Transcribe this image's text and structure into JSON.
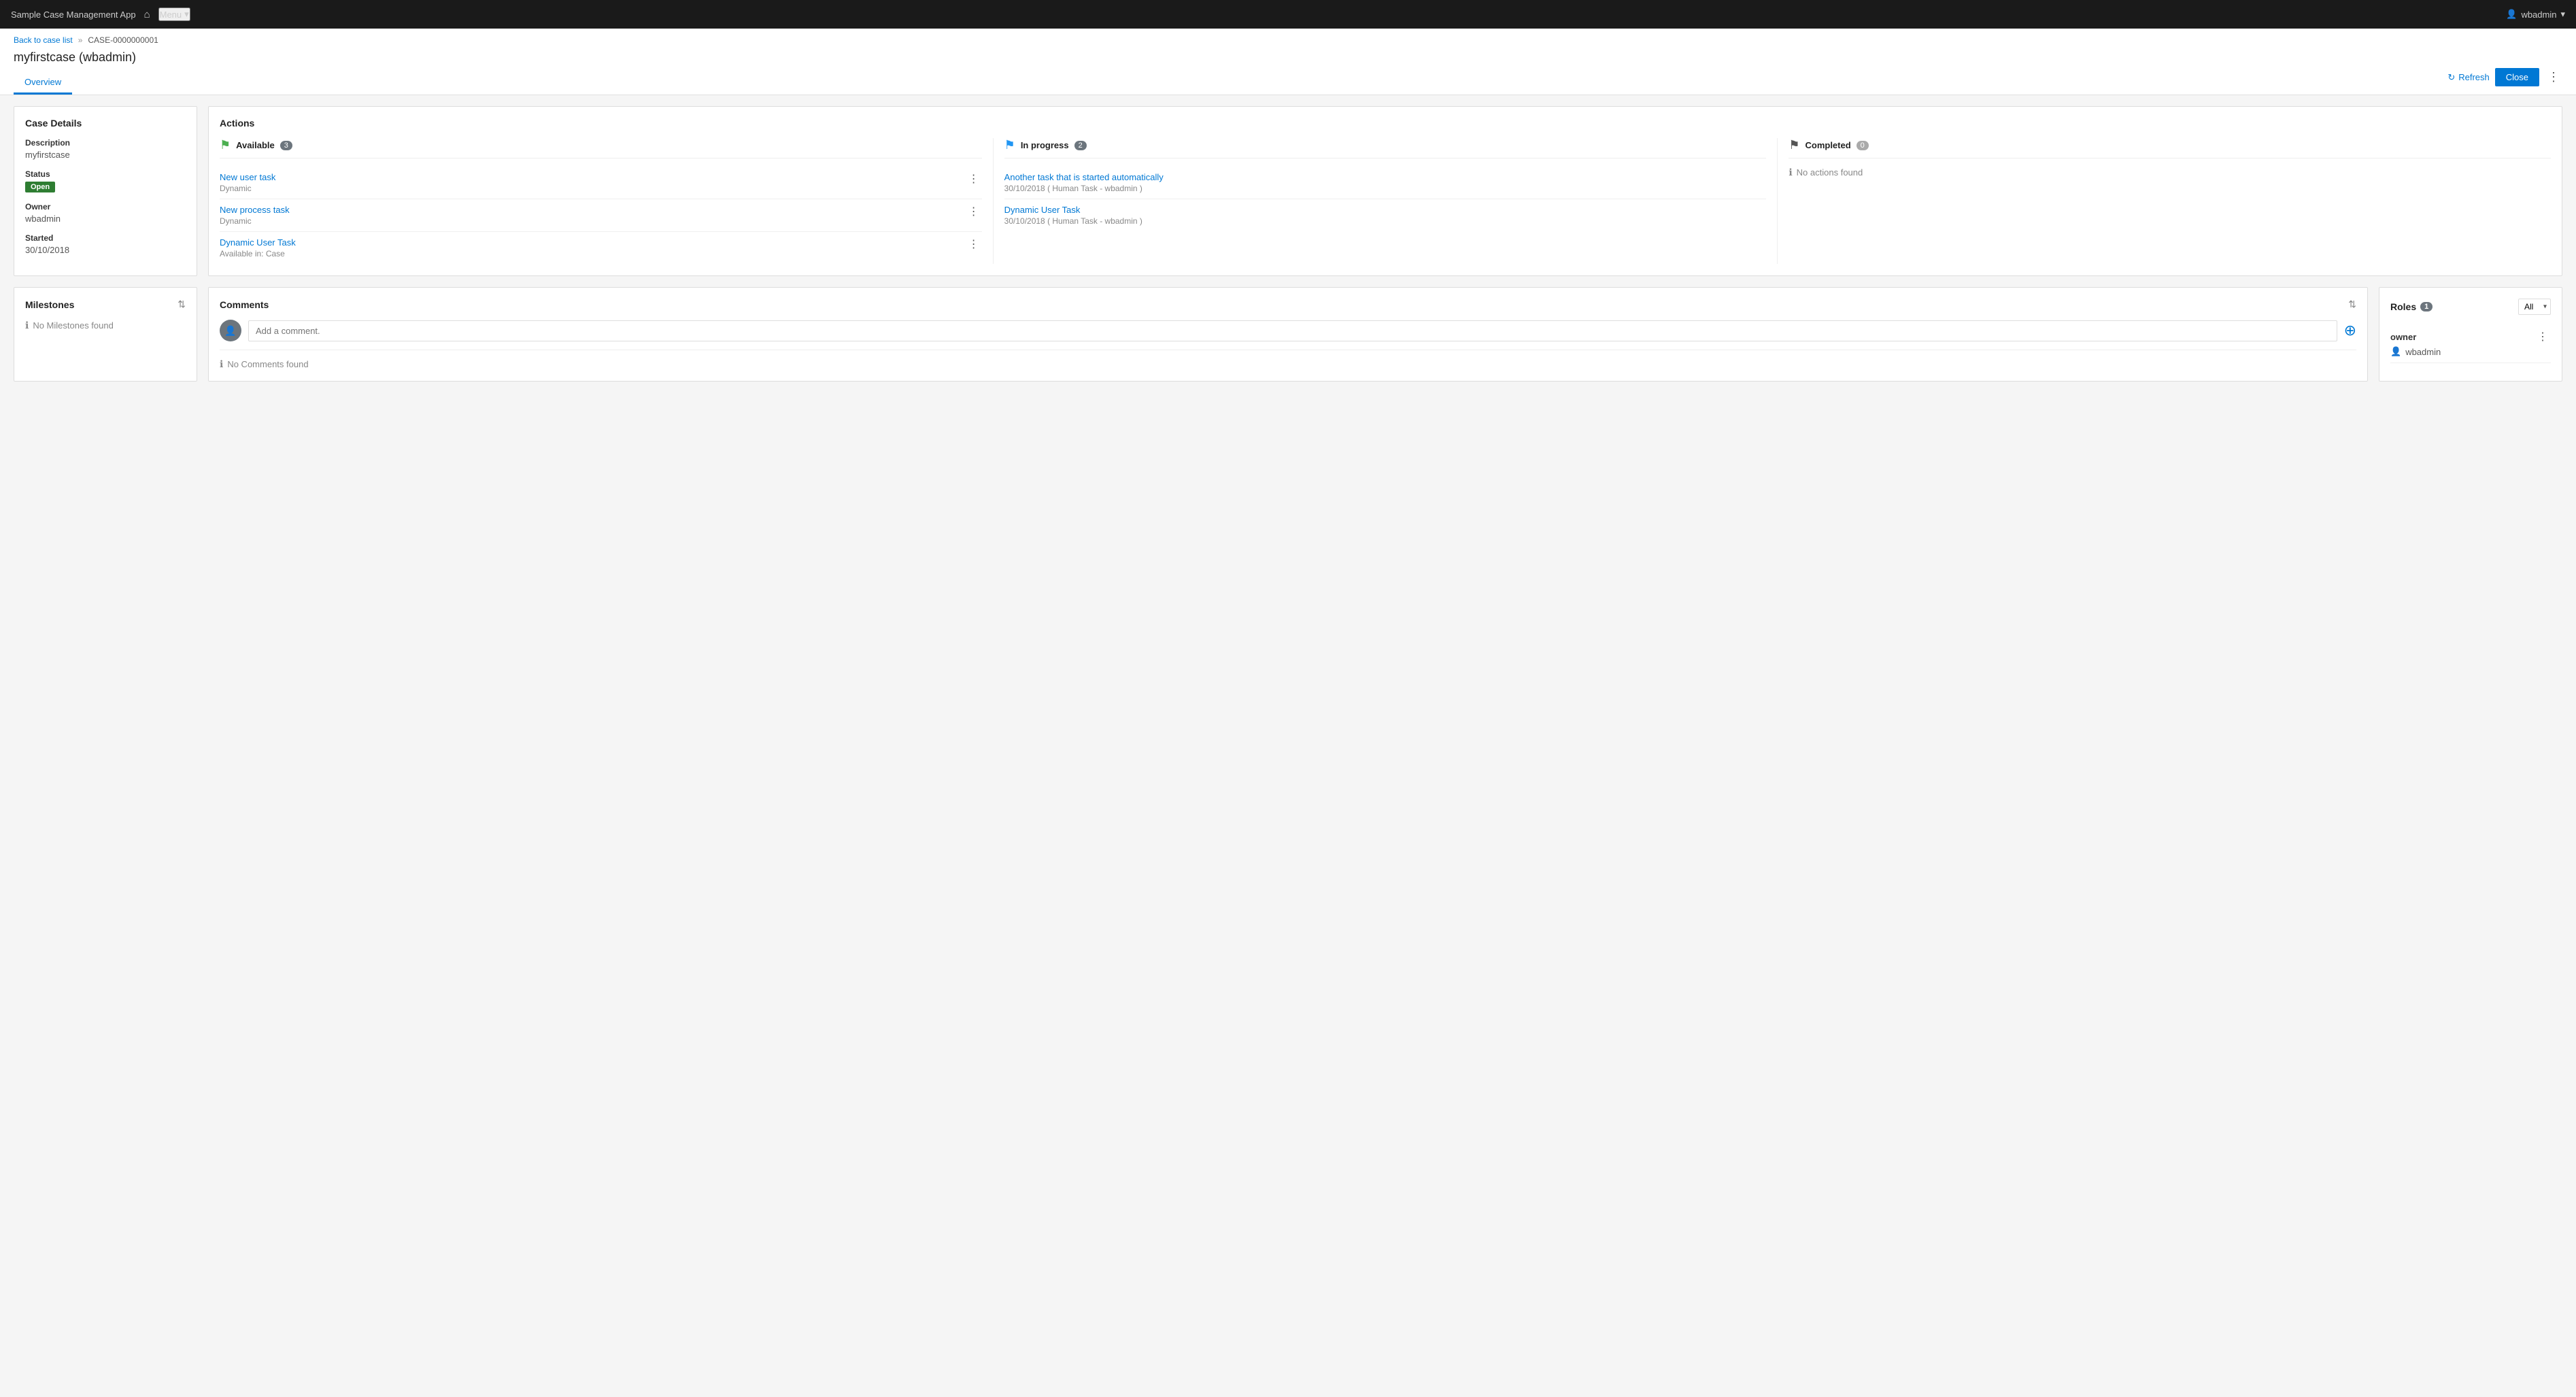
{
  "app": {
    "title": "Sample Case Management App",
    "menu_label": "Menu",
    "user": "wbadmin"
  },
  "breadcrumb": {
    "back_link": "Back to case list",
    "separator": "»",
    "current": "CASE-0000000001"
  },
  "case": {
    "title": "myfirstcase (wbadmin)",
    "refresh_label": "Refresh",
    "close_label": "Close",
    "description_label": "Description",
    "description_value": "myfirstcase",
    "status_label": "Status",
    "status_value": "Open",
    "owner_label": "Owner",
    "owner_value": "wbadmin",
    "started_label": "Started",
    "started_value": "30/10/2018"
  },
  "tabs": [
    {
      "label": "Overview",
      "active": true
    }
  ],
  "actions": {
    "title": "Actions",
    "available": {
      "label": "Available",
      "count": "3",
      "items": [
        {
          "name": "New user task",
          "sub": "Dynamic"
        },
        {
          "name": "New process task",
          "sub": "Dynamic"
        },
        {
          "name": "Dynamic User Task",
          "sub": "Available in: Case"
        }
      ]
    },
    "in_progress": {
      "label": "In progress",
      "count": "2",
      "items": [
        {
          "name": "Another task that is started automatically",
          "sub": "30/10/2018 ( Human Task - wbadmin )"
        },
        {
          "name": "Dynamic User Task",
          "sub": "30/10/2018 ( Human Task - wbadmin )"
        }
      ]
    },
    "completed": {
      "label": "Completed",
      "count": "0",
      "no_actions_text": "No actions found"
    }
  },
  "milestones": {
    "title": "Milestones",
    "no_data_text": "No Milestones found"
  },
  "comments": {
    "title": "Comments",
    "input_placeholder": "Add a comment.",
    "no_data_text": "No Comments found"
  },
  "roles": {
    "title": "Roles",
    "count": "1",
    "filter_label": "All",
    "items": [
      {
        "role": "owner",
        "user": "wbadmin"
      }
    ]
  }
}
